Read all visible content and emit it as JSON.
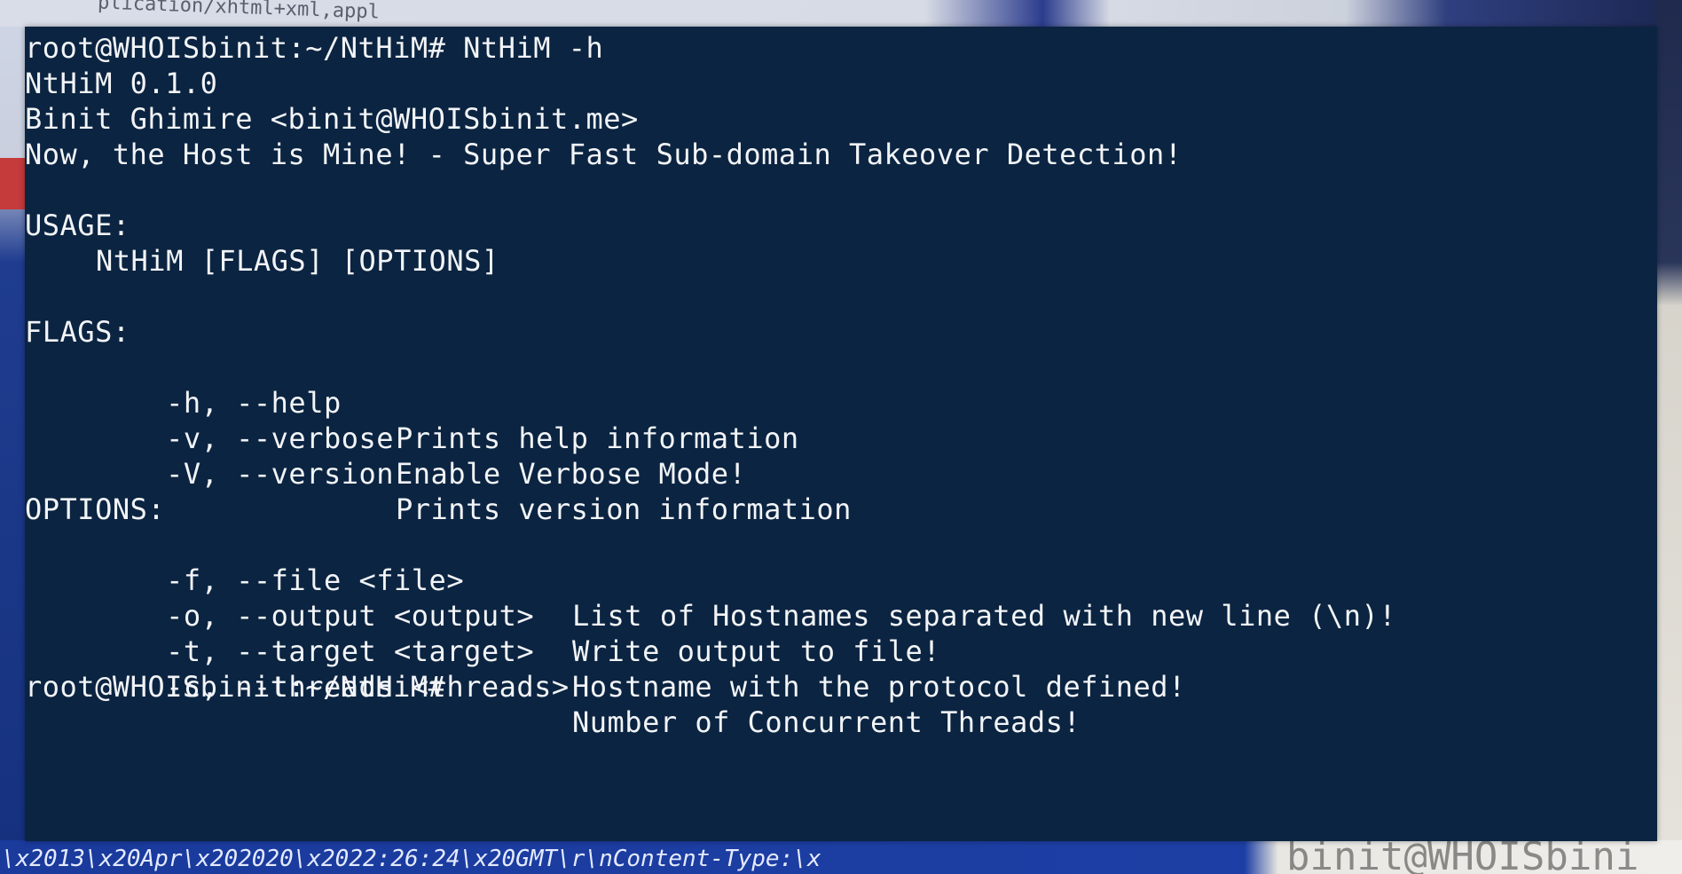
{
  "terminal": {
    "prompt": "root@WHOISbinit:~/NtHiM#",
    "command": "NtHiM -h",
    "app_version": "NtHiM 0.1.0",
    "author": "Binit Ghimire <binit@WHOISbinit.me>",
    "tagline": "Now, the Host is Mine! - Super Fast Sub-domain Takeover Detection!",
    "usage_header": "USAGE:",
    "usage_line": "NtHiM [FLAGS] [OPTIONS]",
    "flags_header": "FLAGS:",
    "flags": [
      {
        "flag": "-h, --help",
        "desc": "Prints help information"
      },
      {
        "flag": "-v, --verbose",
        "desc": "Enable Verbose Mode!"
      },
      {
        "flag": "-V, --version",
        "desc": "Prints version information"
      }
    ],
    "options_header": "OPTIONS:",
    "options": [
      {
        "flag": "-f, --file <file>",
        "desc": "List of Hostnames separated with new line (\\n)!"
      },
      {
        "flag": "-o, --output <output>",
        "desc": "Write output to file!"
      },
      {
        "flag": "-t, --target <target>",
        "desc": "Hostname with the protocol defined!"
      },
      {
        "flag": "-c, --threads <threads>",
        "desc": "Number of Concurrent Threads!"
      }
    ],
    "final_prompt": "root@WHOISbinit:~/NtHiM#"
  },
  "background": {
    "bottom_text": "\\x2013\\x20Apr\\x202020\\x2022:26:24\\x20GMT\\r\\nContent-Type:\\x",
    "top_text": "plication/xhtml+xml,appl",
    "right_text": "binit@WHOISbini"
  },
  "colors": {
    "terminal_bg": "#0b2441",
    "terminal_fg": "#f2f4f7"
  }
}
